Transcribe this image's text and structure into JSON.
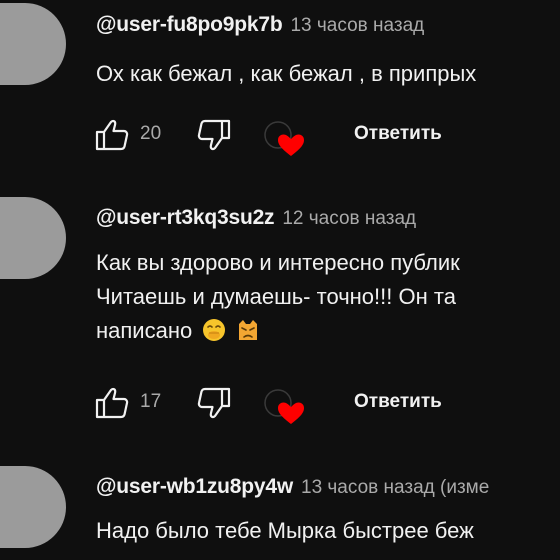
{
  "comments": [
    {
      "author": "@user-fu8po9pk7b",
      "time": "13 часов назад",
      "lines": [
        "Ох как бежал , как бежал , в припрых"
      ],
      "likes": "20",
      "reply_label": "Ответить",
      "creator_heart": true
    },
    {
      "author": "@user-rt3kq3su2z",
      "time": "12 часов назад",
      "lines": [
        "Как вы здорово и интересно  публик",
        "Читаешь и думаешь-  точно!!!  Он  та",
        "написано"
      ],
      "emojis": [
        "face-with-hand-over-mouth-emoji",
        "pouting-cat-emoji"
      ],
      "likes": "17",
      "reply_label": "Ответить",
      "creator_heart": true
    },
    {
      "author": "@user-wb1zu8py4w",
      "time": "13 часов назад (изме",
      "lines": [
        "Надо было тебе Мырка быстрее беж"
      ]
    }
  ],
  "colors": {
    "background": "#0f0f0f",
    "text": "#f1f1f1",
    "secondary_text": "#aaaaaa",
    "avatar": "#9b9b9b",
    "heart": "#ff0000"
  },
  "icons": [
    "like-icon",
    "dislike-icon",
    "creator-heart-icon"
  ]
}
